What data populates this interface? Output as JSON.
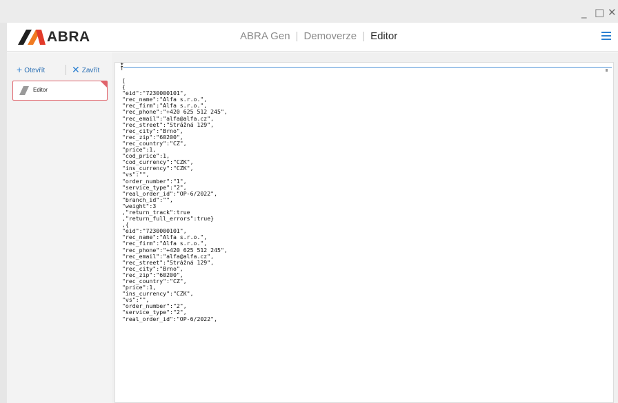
{
  "window": {
    "minimize_label": "_",
    "maximize_label": "□",
    "close_label": "✕"
  },
  "header": {
    "logo_text": "ABRA",
    "breadcrumb": [
      "ABRA Gen",
      "Demoverze",
      "Editor"
    ],
    "menu_icon": "hamburger-icon",
    "accent_color": "#2a7fd1"
  },
  "sidebar": {
    "open_label": "Otevřít",
    "close_label": "Zavřít",
    "open_icon": "plus-icon",
    "close_icon": "x-icon",
    "document_tab": {
      "label": "Editor",
      "marker_color": "#e0636b"
    }
  },
  "editor": {
    "lines": [
      "[",
      "{",
      "\"eid\":\"7230000101\",",
      "\"rec_name\":\"Alfa s.r.o.\",",
      "\"rec_firm\":\"Alfa s.r.o.\",",
      "\"rec_phone\":\"+420 625 512 245\",",
      "\"rec_email\":\"alfa@alfa.cz\",",
      "\"rec_street\":\"Strážná 129\",",
      "\"rec_city\":\"Brno\",",
      "\"rec_zip\":\"60200\",",
      "\"rec_country\":\"CZ\",",
      "\"price\":1,",
      "\"cod_price\":1,",
      "\"cod_currency\":\"CZK\",",
      "\"ins_currency\":\"CZK\",",
      "\"vs\":\"\",",
      "\"order_number\":\"1\",",
      "\"service_type\":\"2\",",
      "\"real_order_id\":\"OP-6/2022\",",
      "\"branch_id\":\"\",",
      "\"weight\":3",
      ",\"return_track\":true",
      ",\"return_full_errors\":true}",
      ",{",
      "\"eid\":\"7230000101\",",
      "\"rec_name\":\"Alfa s.r.o.\",",
      "\"rec_firm\":\"Alfa s.r.o.\",",
      "\"rec_phone\":\"+420 625 512 245\",",
      "\"rec_email\":\"alfa@alfa.cz\",",
      "\"rec_street\":\"Strážná 129\",",
      "\"rec_city\":\"Brno\",",
      "\"rec_zip\":\"60200\",",
      "\"rec_country\":\"CZ\",",
      "\"price\":1,",
      "\"ins_currency\":\"CZK\",",
      "\"vs\":\"\",",
      "\"order_number\":\"2\",",
      "\"service_type\":\"2\",",
      "\"real_order_id\":\"OP-6/2022\","
    ]
  }
}
